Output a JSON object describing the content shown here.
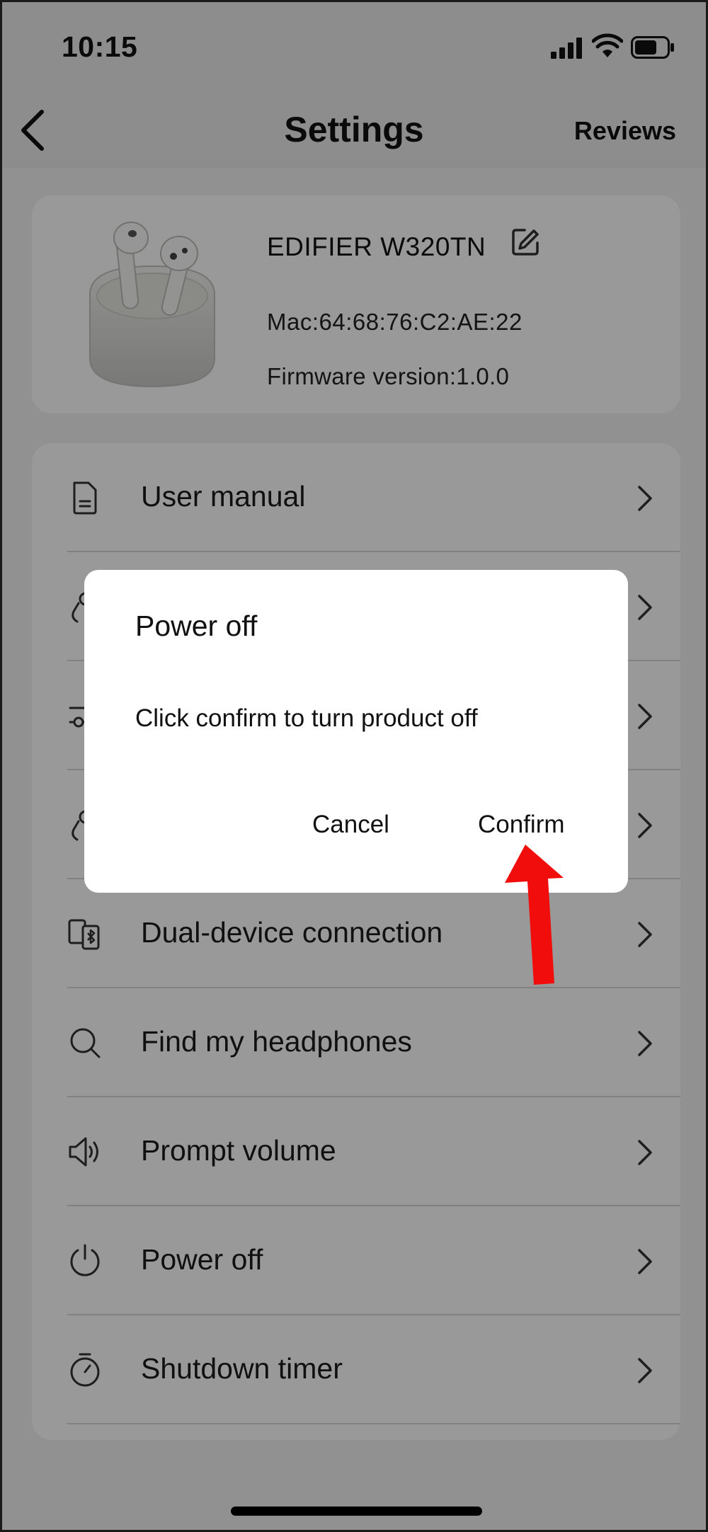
{
  "status_bar": {
    "time": "10:15"
  },
  "nav": {
    "title": "Settings",
    "reviews_label": "Reviews"
  },
  "device": {
    "name": "EDIFIER W320TN",
    "mac": "Mac:64:68:76:C2:AE:22",
    "firmware": "Firmware version:1.0.0"
  },
  "menu": {
    "items": [
      {
        "label": "User manual",
        "icon": "document-icon"
      },
      {
        "label": "",
        "icon": "gesture-icon"
      },
      {
        "label": "",
        "icon": "sliders-icon"
      },
      {
        "label": "",
        "icon": "gesture-icon"
      },
      {
        "label": "Dual-device connection",
        "icon": "dual-device-icon"
      },
      {
        "label": "Find my headphones",
        "icon": "search-icon"
      },
      {
        "label": "Prompt volume",
        "icon": "speaker-icon"
      },
      {
        "label": "Power off",
        "icon": "power-icon"
      },
      {
        "label": "Shutdown timer",
        "icon": "timer-icon"
      }
    ]
  },
  "dialog": {
    "title": "Power off",
    "message": "Click confirm to turn product off",
    "cancel_label": "Cancel",
    "confirm_label": "Confirm"
  },
  "annotation": {
    "arrow_color": "#f20d0d"
  }
}
